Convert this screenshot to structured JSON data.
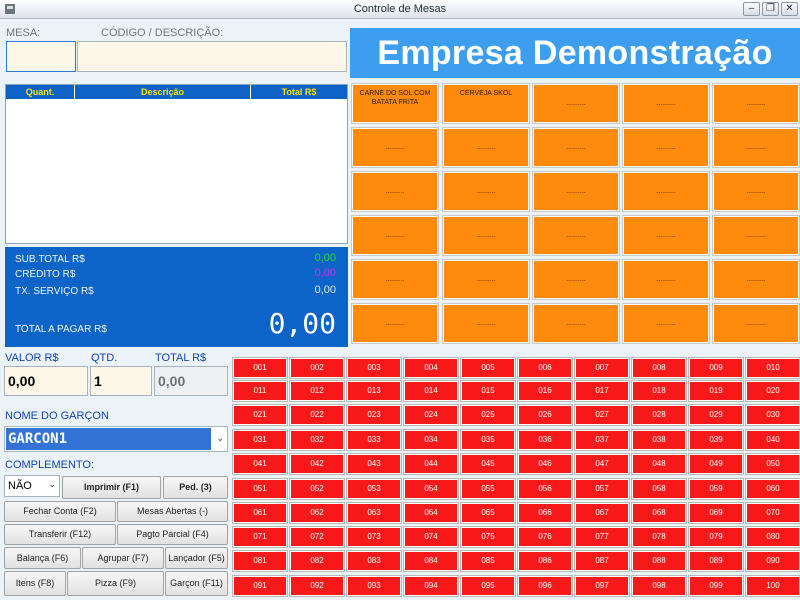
{
  "window": {
    "title": "Controle de Mesas",
    "min": "–",
    "max": "❐",
    "close": "✕"
  },
  "labels": {
    "mesa": "MESA:",
    "codigo": "CÓDIGO / DESCRIÇÃO:"
  },
  "company": "Empresa Demonstração",
  "items_table": {
    "columns": [
      "Quant.",
      "Descrição",
      "Total R$"
    ]
  },
  "totals": {
    "subtotal_label": "SUB.TOTAL R$",
    "subtotal_value": "0,00",
    "subtotal_color": "#22dd33",
    "credito_label": "CRÉDITO R$",
    "credito_value": "0,00",
    "credito_color": "#d030f0",
    "servico_label": "TX. SERVIÇO R$",
    "servico_value": "0,00",
    "total_label": "TOTAL A PAGAR R$",
    "total_value": "0,00"
  },
  "products": [
    "CARNE DO SOL COM BATATA FRITA",
    "CERVEJA SKOL",
    "..........",
    "..........",
    "..........",
    "..........",
    "..........",
    "..........",
    "..........",
    "..........",
    "..........",
    "..........",
    "..........",
    "..........",
    "..........",
    "..........",
    "..........",
    "..........",
    "..........",
    "..........",
    "..........",
    "..........",
    "..........",
    "..........",
    "..........",
    "..........",
    "..........",
    "..........",
    "..........",
    ".........."
  ],
  "fields": {
    "valor_label": "VALOR R$",
    "valor": "0,00",
    "qtd_label": "QTD.",
    "qtd": "1",
    "total_label": "TOTAL R$",
    "total": "0,00",
    "garcom_label": "NOME DO GARÇON",
    "garcom": "GARCON1",
    "complemento_label": "COMPLEMENTO:",
    "complemento": "NÃO"
  },
  "buttons": {
    "imprimir": "Imprimir (F1)",
    "ped": "Ped. (3)",
    "fechar": "Fechar Conta (F2)",
    "mesas_abertas": "Mesas Abertas (-)",
    "transferir": "Transferir (F12)",
    "pagto_parcial": "Pagto Parcial (F4)",
    "balanca": "Balança (F6)",
    "agrupar": "Agrupar (F7)",
    "lancador": "Lançador (F5)",
    "itens": "Itens (F8)",
    "pizza": "Pizza (F9)",
    "garcom": "Garçon (F11)"
  },
  "mesas": [
    "001",
    "002",
    "003",
    "004",
    "005",
    "006",
    "007",
    "008",
    "009",
    "010",
    "011",
    "012",
    "013",
    "014",
    "015",
    "016",
    "017",
    "018",
    "019",
    "020",
    "021",
    "022",
    "023",
    "024",
    "025",
    "026",
    "027",
    "028",
    "029",
    "030",
    "031",
    "032",
    "033",
    "034",
    "035",
    "036",
    "037",
    "038",
    "039",
    "040",
    "041",
    "042",
    "043",
    "044",
    "045",
    "046",
    "047",
    "048",
    "049",
    "050",
    "051",
    "052",
    "053",
    "054",
    "055",
    "056",
    "057",
    "058",
    "059",
    "060",
    "061",
    "062",
    "063",
    "064",
    "065",
    "066",
    "067",
    "068",
    "069",
    "070",
    "071",
    "072",
    "073",
    "074",
    "075",
    "076",
    "077",
    "078",
    "079",
    "080",
    "081",
    "082",
    "083",
    "084",
    "085",
    "086",
    "087",
    "088",
    "089",
    "090",
    "091",
    "092",
    "093",
    "094",
    "095",
    "096",
    "097",
    "098",
    "099",
    "100"
  ]
}
